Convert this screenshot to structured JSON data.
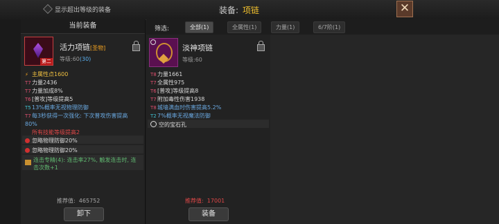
{
  "topbar": {
    "checkbox_label": "显示超出等级的装备",
    "title": "装备:",
    "title_value": "项链",
    "close_icon": "close-icon"
  },
  "filter": {
    "label": "筛选:",
    "tabs": [
      "全部(1)",
      "全属性(1)",
      "力量(1)",
      "6/7阶(1)"
    ]
  },
  "left": {
    "header": "当前装备",
    "name": "活力项链",
    "name_tag": "[圣物]",
    "level": "等级:60",
    "level_bonus": "(30)",
    "badge": "第二",
    "stats": [
      {
        "tier": "⚡",
        "text": "主属性点1600"
      },
      {
        "tier": "T7",
        "text": "力量2436"
      },
      {
        "tier": "T7",
        "text": "力量加成8%"
      },
      {
        "tier": "T6",
        "text": "[普攻]等级提高5"
      },
      {
        "tier": "T5",
        "text": "13%概率无视物理防御"
      },
      {
        "tier": "T7",
        "text": "每3秒获得一次强化: 下次普攻伤害提高80%"
      },
      {
        "tier": "",
        "text": "所有技能等级提高2"
      }
    ],
    "gems": [
      "忽略物理防御20%",
      "忽略物理防御20%"
    ],
    "set_text": "连击专精(4): 连击率27%, 触发连击时, 连击次数+1",
    "score_label": "推荐值:",
    "score": "465752",
    "button": "卸下"
  },
  "mid": {
    "name": "淡神项链",
    "level": "等级:60",
    "stats": [
      {
        "tier": "T8",
        "text": "力量1661"
      },
      {
        "tier": "T7",
        "text": "全属性975"
      },
      {
        "tier": "T6",
        "text": "[普攻]等级提高8"
      },
      {
        "tier": "T7",
        "text": "附加毒性伤害1938"
      },
      {
        "tier": "T8",
        "text": "城墙满血时伤害提高5.2%"
      },
      {
        "tier": "T2",
        "text": "7%概率无视魔法防御"
      }
    ],
    "socket": "空的宝石孔",
    "score_label": "推荐值:",
    "score": "17001",
    "button": "装备"
  }
}
